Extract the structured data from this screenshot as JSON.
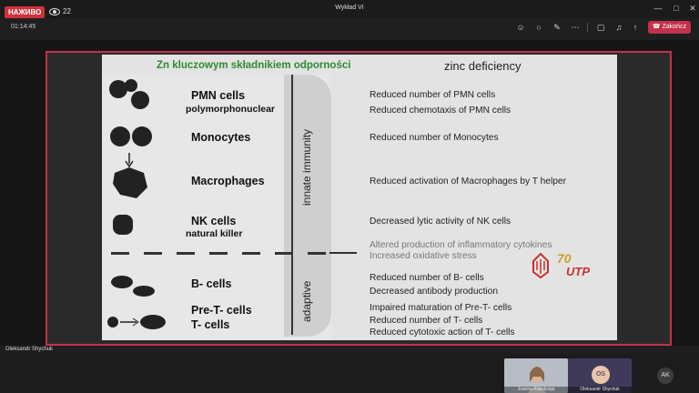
{
  "window": {
    "title": "Wykład VI",
    "live_badge": "НАЖИВО",
    "viewer_count": "22"
  },
  "meeting": {
    "timer": "01:14:45",
    "end_label": "Zakończ"
  },
  "slide": {
    "heading_pl": "Zn kluczowym składnikiem odporności",
    "heading_en": "zinc deficiency",
    "category_innate": "innate immunity",
    "category_adaptive": "adaptive",
    "cells": [
      {
        "name": "PMN cells",
        "sub": "polymorphonuclear"
      },
      {
        "name": "Monocytes",
        "sub": ""
      },
      {
        "name": "Macrophages",
        "sub": ""
      },
      {
        "name": "NK cells",
        "sub": "natural killer"
      },
      {
        "name": "B- cells",
        "sub": ""
      },
      {
        "name": "Pre-T- cells",
        "sub": ""
      },
      {
        "name": "T- cells",
        "sub": ""
      }
    ],
    "deficiency": [
      "Reduced number of PMN cells",
      "Reduced chemotaxis of PMN cells",
      "Reduced number of Monocytes",
      "Reduced activation of Macrophages by T helper",
      "Decreased lytic activity of NK cells",
      "Altered production of inflammatory cytokines",
      "Increased oxidative stress",
      "Reduced number of B- cells",
      "Decreased antibody production",
      "Impaired maturation of Pre-T- cells",
      "Reduced number of T- cells",
      "Reduced cytotoxic action of T- cells"
    ],
    "logo_text": "70 UTP"
  },
  "participants": {
    "presenter": "Oleksandr Shychuk",
    "tile1": "Joanna Kołodzieja",
    "tile2": "Oleksandr Shychuk",
    "tile2_initials": "OS",
    "extra_initials": "AK"
  },
  "icons": [
    "eye-icon",
    "minimize-icon",
    "maximize-icon",
    "close-icon",
    "participants-icon",
    "chat-icon",
    "reactions-icon",
    "more-icon",
    "camera-icon",
    "mic-icon",
    "share-icon",
    "phone-icon"
  ]
}
